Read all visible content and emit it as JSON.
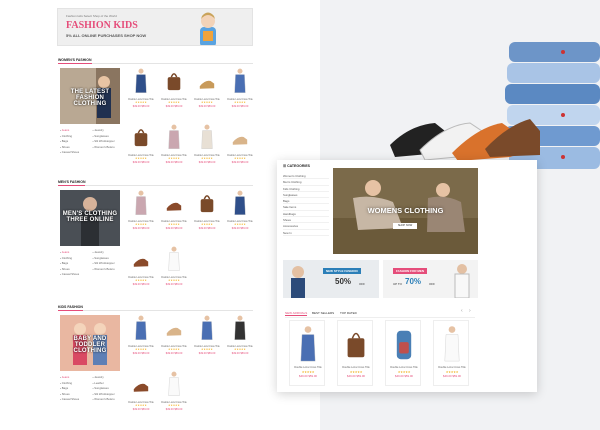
{
  "banner": {
    "small_text": "Fashion kids Select Shop of the World",
    "title": "FASHION KIDS",
    "subtitle": "5% ALL ONLINE PURCHASES SHOP NOW"
  },
  "sections": [
    {
      "title": "WOMEN'S FASHION",
      "feature_text": "THE LATEST FASHION CLOTHING",
      "categories": [
        {
          "label": "Jeans",
          "active": true
        },
        {
          "label": "Clothing"
        },
        {
          "label": "Bags"
        },
        {
          "label": "Shoes"
        },
        {
          "label": "Casual Shoes"
        },
        {
          "label": "Jewelry"
        },
        {
          "label": "Sunglasses"
        },
        {
          "label": "Slit Windstopper"
        },
        {
          "label": "Women's Bolero"
        }
      ],
      "products": [
        "shirt",
        "bag",
        "heels",
        "dress",
        "bag",
        "sweater",
        "blouse",
        "sandals"
      ]
    },
    {
      "title": "MEN'S FASHION",
      "feature_text": "MEN'S CLOTHING THREE ONLINE",
      "categories": [
        {
          "label": "Jeans",
          "active": true
        },
        {
          "label": "Clothing"
        },
        {
          "label": "Bags"
        },
        {
          "label": "Shoes"
        },
        {
          "label": "Casual Shoes"
        },
        {
          "label": "Jewelry"
        },
        {
          "label": "Sunglasses"
        },
        {
          "label": "Slit Windstopper"
        },
        {
          "label": "Women's Bolero"
        }
      ],
      "products": [
        "sweater",
        "shoes",
        "bag",
        "shirt",
        "shoes",
        "tshirt"
      ]
    },
    {
      "title": "KIDS FASHION",
      "feature_text": "BABY AND TODDLER CLOTHING",
      "categories": [
        {
          "label": "Jeans",
          "active": true
        },
        {
          "label": "Clothing"
        },
        {
          "label": "Bags"
        },
        {
          "label": "Shoes"
        },
        {
          "label": "Casual Shoes"
        },
        {
          "label": "Jewelry"
        },
        {
          "label": "Leather"
        },
        {
          "label": "Sunglasses"
        },
        {
          "label": "Slit Windstopper"
        },
        {
          "label": "Women's Bolero"
        }
      ],
      "products": [
        "dress",
        "sandals",
        "dress",
        "hoodie",
        "shoes",
        "tshirt"
      ]
    }
  ],
  "product_defaults": {
    "name": "Double Loza Cross Title",
    "stars": "★★★★★",
    "price": "$49.00 $59.00"
  },
  "window": {
    "side_title": "CATEGORIES",
    "side_items": [
      "Women's Clothing",
      "Men's Clothing",
      "Kids Clothing",
      "Sunglasses",
      "Bags",
      "Sale Items",
      "Handbags",
      "Shoes",
      "Accessories",
      "New In"
    ],
    "hero_title": "WOMENS CLOTHING",
    "hero_button": "SHOP NOW",
    "promo_left_tag": "NEW STYLE FASHION",
    "promo_left_value": "50%",
    "promo_left_suffix": "OFF",
    "promo_right_tag": "FASHION FOR MEN",
    "promo_right_prefix": "UP TO",
    "promo_right_value": "70%",
    "promo_right_suffix": "OFF",
    "tabs": [
      "NEW ARRIVALS",
      "BEST SELLERS",
      "TOP RATED"
    ],
    "products": [
      "dress",
      "bag",
      "backpack",
      "tshirt"
    ]
  },
  "colors": {
    "accent": "#e54d7a",
    "star": "#f2b01e"
  }
}
